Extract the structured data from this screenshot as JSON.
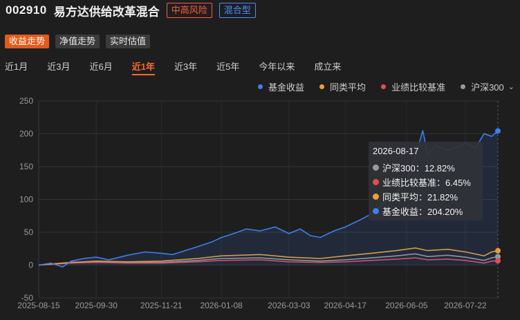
{
  "header": {
    "code": "002910",
    "name": "易方达供给改革混合",
    "risk_tag": "中高风险",
    "type_tag": "混合型"
  },
  "buttons": [
    {
      "label": "收益走势",
      "active": true
    },
    {
      "label": "净值走势",
      "active": false
    },
    {
      "label": "实时估值",
      "active": false
    }
  ],
  "periods": [
    {
      "label": "近1月",
      "active": false
    },
    {
      "label": "近3月",
      "active": false
    },
    {
      "label": "近6月",
      "active": false
    },
    {
      "label": "近1年",
      "active": true
    },
    {
      "label": "近3年",
      "active": false
    },
    {
      "label": "近5年",
      "active": false
    },
    {
      "label": "今年以来",
      "active": false
    },
    {
      "label": "成立来",
      "active": false
    }
  ],
  "legend": [
    {
      "label": "基金收益",
      "color": "#3d7ff0"
    },
    {
      "label": "同类平均",
      "color": "#f0a030"
    },
    {
      "label": "业绩比较基准",
      "color": "#e84c4c"
    },
    {
      "label": "沪深300",
      "color": "#9a9a9a"
    }
  ],
  "tooltip": {
    "date": "2026-08-17",
    "rows": [
      {
        "text": "沪深300：12.82%",
        "color": "#9a9a9a"
      },
      {
        "text": "业绩比较基准：6.45%",
        "color": "#e84c4c"
      },
      {
        "text": "同类平均：21.82%",
        "color": "#f0a030"
      },
      {
        "text": "基金收益：204.20%",
        "color": "#3d7ff0"
      }
    ]
  },
  "chart_data": {
    "type": "line",
    "ylim": [
      -50,
      250
    ],
    "yticks": [
      250,
      200,
      150,
      100,
      50,
      0,
      -50
    ],
    "xlim": [
      "2025-08-15",
      "2026-08-17"
    ],
    "xtick_labels": [
      "2025-08-15",
      "2025-09-30",
      "2025-11-21",
      "2026-01-08",
      "2026-03-03",
      "2026-04-17",
      "2026-06-05",
      "2026-07-22"
    ],
    "grid": true,
    "series": [
      {
        "name": "基金收益",
        "color": "#3d7ff0",
        "fill": true,
        "points": [
          [
            "2025-08-15",
            0
          ],
          [
            "2025-08-25",
            3
          ],
          [
            "2025-09-03",
            -3
          ],
          [
            "2025-09-10",
            6
          ],
          [
            "2025-09-20",
            10
          ],
          [
            "2025-09-30",
            12
          ],
          [
            "2025-10-10",
            8
          ],
          [
            "2025-10-25",
            15
          ],
          [
            "2025-11-08",
            20
          ],
          [
            "2025-11-21",
            18
          ],
          [
            "2025-11-30",
            16
          ],
          [
            "2025-12-10",
            22
          ],
          [
            "2025-12-20",
            28
          ],
          [
            "2025-12-31",
            35
          ],
          [
            "2026-01-08",
            42
          ],
          [
            "2026-01-18",
            48
          ],
          [
            "2026-01-28",
            55
          ],
          [
            "2026-02-08",
            52
          ],
          [
            "2026-02-20",
            58
          ],
          [
            "2026-03-03",
            48
          ],
          [
            "2026-03-12",
            55
          ],
          [
            "2026-03-20",
            45
          ],
          [
            "2026-03-28",
            42
          ],
          [
            "2026-04-08",
            52
          ],
          [
            "2026-04-17",
            58
          ],
          [
            "2026-04-28",
            68
          ],
          [
            "2026-05-08",
            78
          ],
          [
            "2026-05-18",
            95
          ],
          [
            "2026-05-28",
            110
          ],
          [
            "2026-06-05",
            128
          ],
          [
            "2026-06-12",
            165
          ],
          [
            "2026-06-18",
            205
          ],
          [
            "2026-06-22",
            168
          ],
          [
            "2026-06-28",
            182
          ],
          [
            "2026-07-08",
            175
          ],
          [
            "2026-07-16",
            180
          ],
          [
            "2026-07-22",
            186
          ],
          [
            "2026-07-30",
            178
          ],
          [
            "2026-08-06",
            200
          ],
          [
            "2026-08-12",
            196
          ],
          [
            "2026-08-17",
            204.2
          ]
        ]
      },
      {
        "name": "同类平均",
        "color": "#f0a030",
        "fill": false,
        "points": [
          [
            "2025-08-15",
            0
          ],
          [
            "2025-09-10",
            4
          ],
          [
            "2025-09-30",
            6
          ],
          [
            "2025-10-25",
            5
          ],
          [
            "2025-11-21",
            6
          ],
          [
            "2025-12-20",
            10
          ],
          [
            "2026-01-08",
            14
          ],
          [
            "2026-02-08",
            16
          ],
          [
            "2026-03-03",
            12
          ],
          [
            "2026-03-28",
            10
          ],
          [
            "2026-04-17",
            14
          ],
          [
            "2026-05-08",
            18
          ],
          [
            "2026-05-28",
            22
          ],
          [
            "2026-06-12",
            26
          ],
          [
            "2026-06-22",
            22
          ],
          [
            "2026-07-08",
            24
          ],
          [
            "2026-07-22",
            20
          ],
          [
            "2026-08-06",
            14
          ],
          [
            "2026-08-12",
            20
          ],
          [
            "2026-08-17",
            21.82
          ]
        ]
      },
      {
        "name": "业绩比较基准",
        "color": "#e84c4c",
        "fill": false,
        "points": [
          [
            "2025-08-15",
            0
          ],
          [
            "2025-09-10",
            3
          ],
          [
            "2025-09-30",
            4
          ],
          [
            "2025-10-25",
            3
          ],
          [
            "2025-11-21",
            3
          ],
          [
            "2025-12-20",
            5
          ],
          [
            "2026-01-08",
            7
          ],
          [
            "2026-02-08",
            8
          ],
          [
            "2026-03-03",
            5
          ],
          [
            "2026-03-28",
            4
          ],
          [
            "2026-04-17",
            5
          ],
          [
            "2026-05-08",
            7
          ],
          [
            "2026-05-28",
            9
          ],
          [
            "2026-06-12",
            11
          ],
          [
            "2026-06-22",
            8
          ],
          [
            "2026-07-08",
            9
          ],
          [
            "2026-07-22",
            7
          ],
          [
            "2026-08-06",
            3
          ],
          [
            "2026-08-12",
            6
          ],
          [
            "2026-08-17",
            6.45
          ]
        ]
      },
      {
        "name": "沪深300",
        "color": "#9a9a9a",
        "fill": false,
        "points": [
          [
            "2025-08-15",
            0
          ],
          [
            "2025-09-10",
            4
          ],
          [
            "2025-09-30",
            5
          ],
          [
            "2025-10-25",
            4
          ],
          [
            "2025-11-21",
            4
          ],
          [
            "2025-12-20",
            7
          ],
          [
            "2026-01-08",
            10
          ],
          [
            "2026-02-08",
            11
          ],
          [
            "2026-03-03",
            8
          ],
          [
            "2026-03-28",
            6
          ],
          [
            "2026-04-17",
            8
          ],
          [
            "2026-05-08",
            11
          ],
          [
            "2026-05-28",
            14
          ],
          [
            "2026-06-12",
            17
          ],
          [
            "2026-06-22",
            13
          ],
          [
            "2026-07-08",
            15
          ],
          [
            "2026-07-22",
            12
          ],
          [
            "2026-08-06",
            7
          ],
          [
            "2026-08-12",
            11
          ],
          [
            "2026-08-17",
            12.82
          ]
        ]
      }
    ]
  }
}
